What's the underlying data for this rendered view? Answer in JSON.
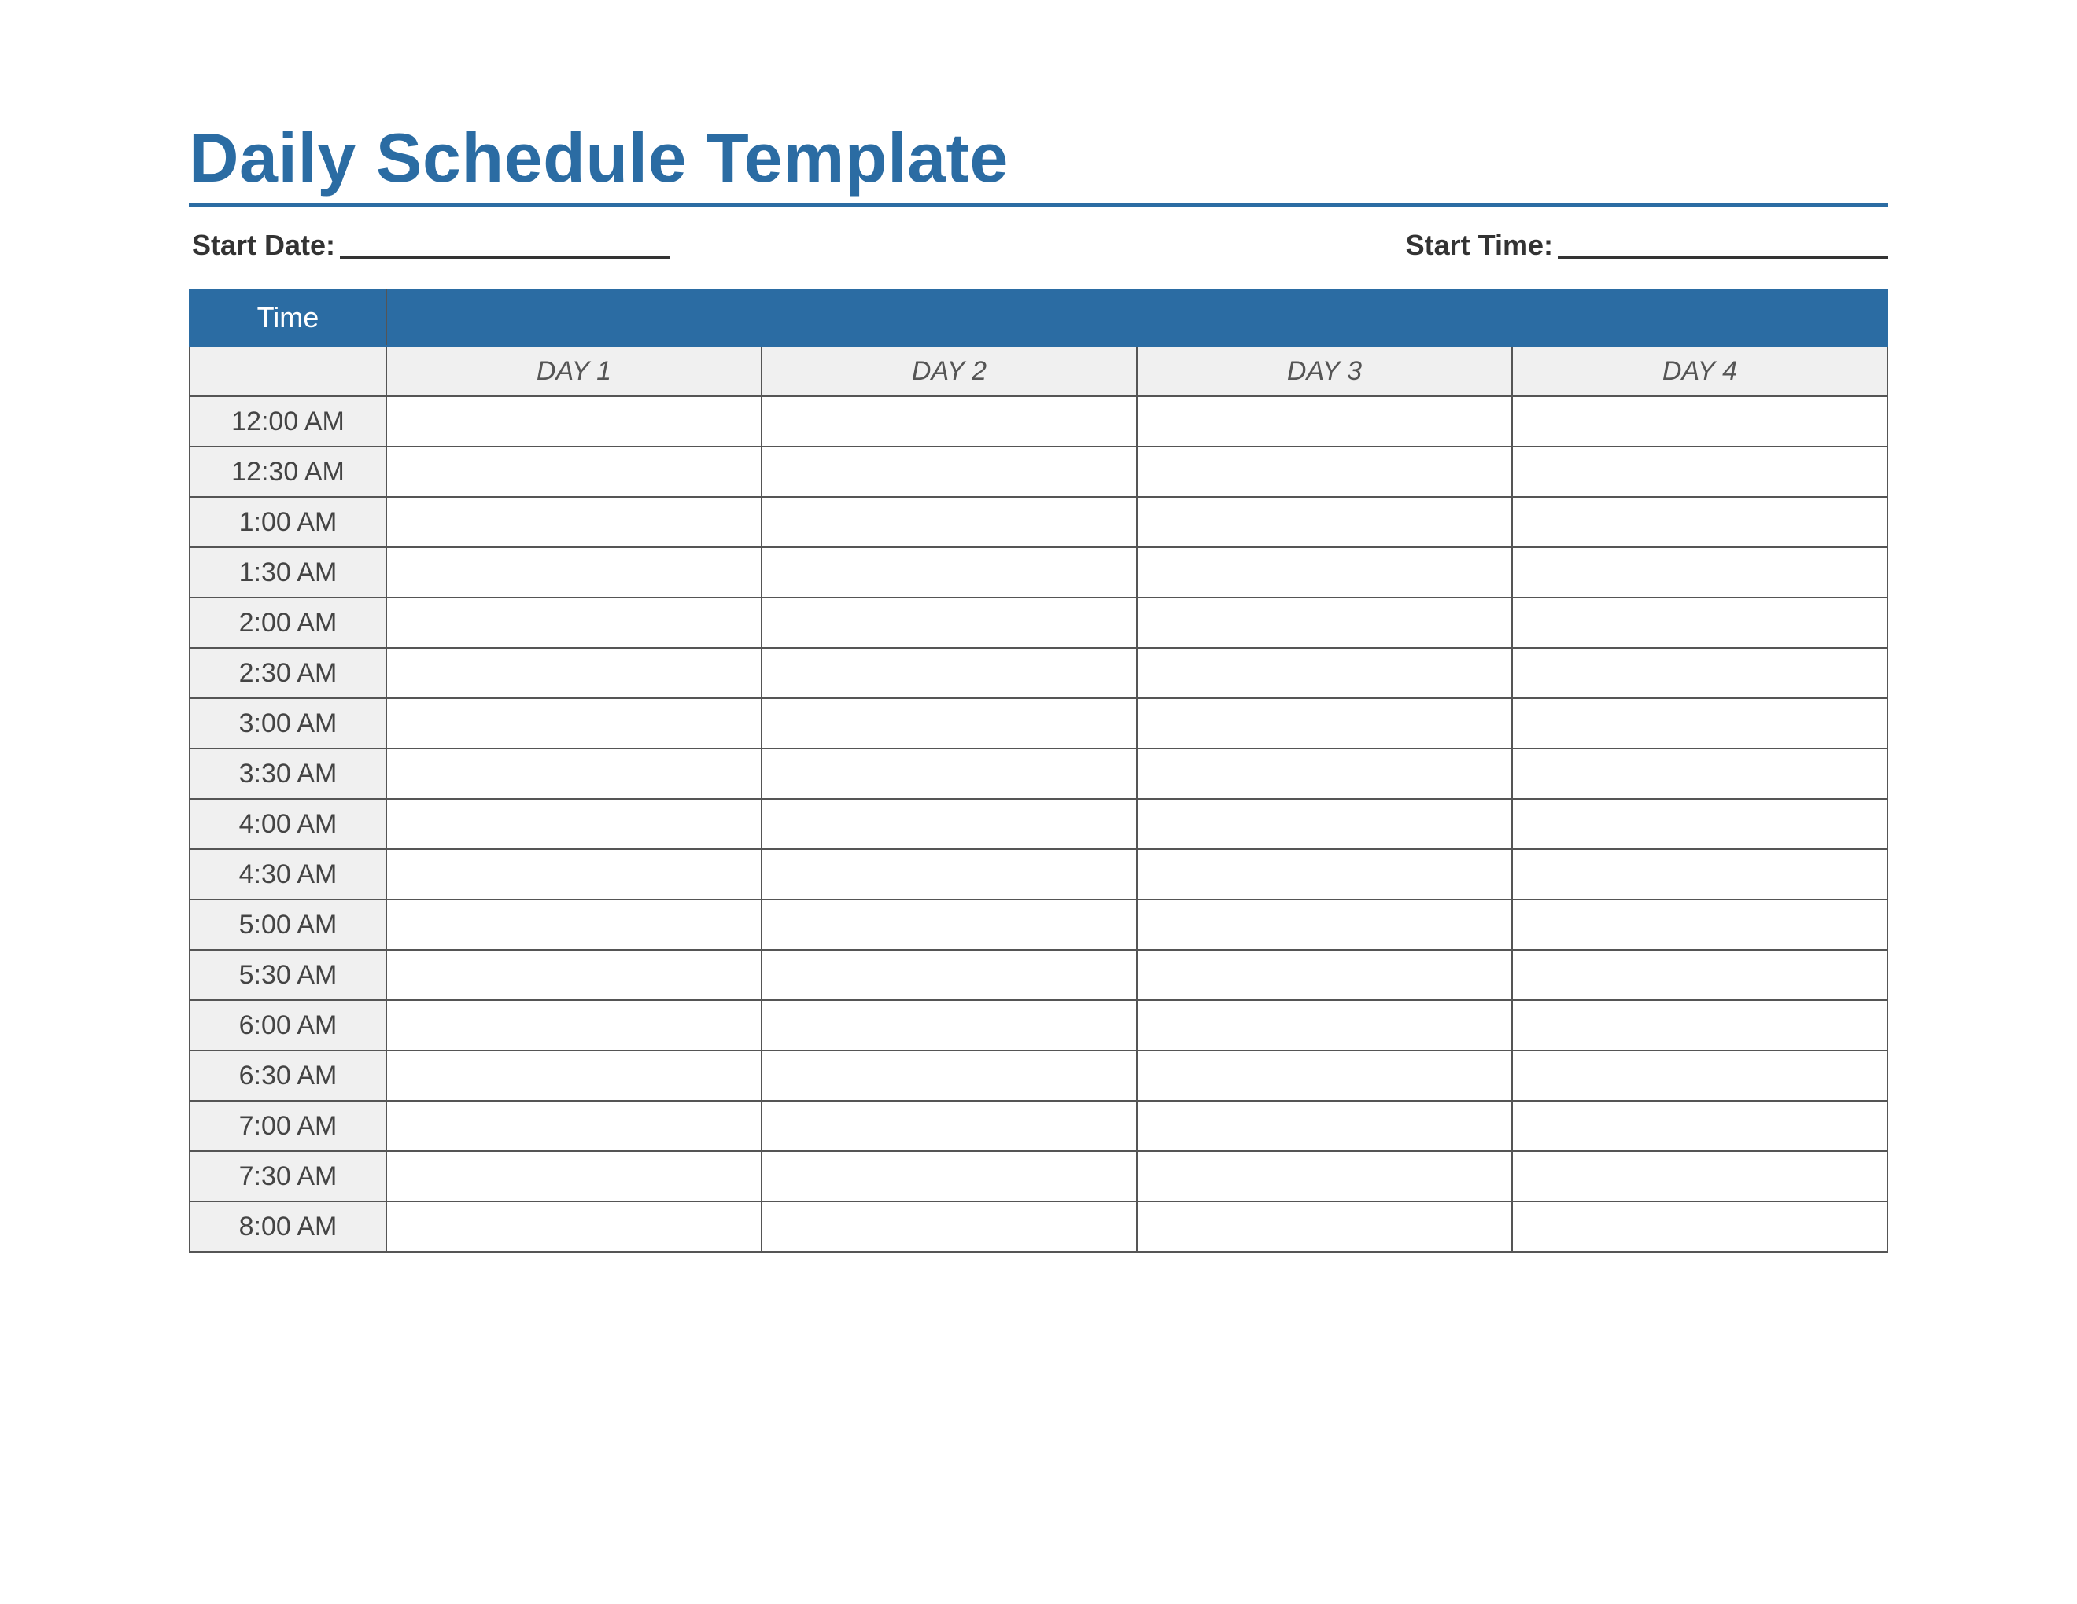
{
  "title": "Daily Schedule Template",
  "meta": {
    "startDateLabel": "Start Date:",
    "startTimeLabel": "Start Time:"
  },
  "headers": {
    "time": "Time",
    "days": [
      "DAY 1",
      "DAY 2",
      "DAY 3",
      "DAY 4"
    ]
  },
  "rows": [
    {
      "time": "12:00 AM",
      "cells": [
        "",
        "",
        "",
        ""
      ]
    },
    {
      "time": "12:30 AM",
      "cells": [
        "",
        "",
        "",
        ""
      ]
    },
    {
      "time": "1:00 AM",
      "cells": [
        "",
        "",
        "",
        ""
      ]
    },
    {
      "time": "1:30 AM",
      "cells": [
        "",
        "",
        "",
        ""
      ]
    },
    {
      "time": "2:00 AM",
      "cells": [
        "",
        "",
        "",
        ""
      ]
    },
    {
      "time": "2:30 AM",
      "cells": [
        "",
        "",
        "",
        ""
      ]
    },
    {
      "time": "3:00 AM",
      "cells": [
        "",
        "",
        "",
        ""
      ]
    },
    {
      "time": "3:30 AM",
      "cells": [
        "",
        "",
        "",
        ""
      ]
    },
    {
      "time": "4:00 AM",
      "cells": [
        "",
        "",
        "",
        ""
      ]
    },
    {
      "time": "4:30 AM",
      "cells": [
        "",
        "",
        "",
        ""
      ]
    },
    {
      "time": "5:00 AM",
      "cells": [
        "",
        "",
        "",
        ""
      ]
    },
    {
      "time": "5:30 AM",
      "cells": [
        "",
        "",
        "",
        ""
      ]
    },
    {
      "time": "6:00 AM",
      "cells": [
        "",
        "",
        "",
        ""
      ]
    },
    {
      "time": "6:30 AM",
      "cells": [
        "",
        "",
        "",
        ""
      ]
    },
    {
      "time": "7:00 AM",
      "cells": [
        "",
        "",
        "",
        ""
      ]
    },
    {
      "time": "7:30 AM",
      "cells": [
        "",
        "",
        "",
        ""
      ]
    },
    {
      "time": "8:00 AM",
      "cells": [
        "",
        "",
        "",
        ""
      ]
    }
  ]
}
